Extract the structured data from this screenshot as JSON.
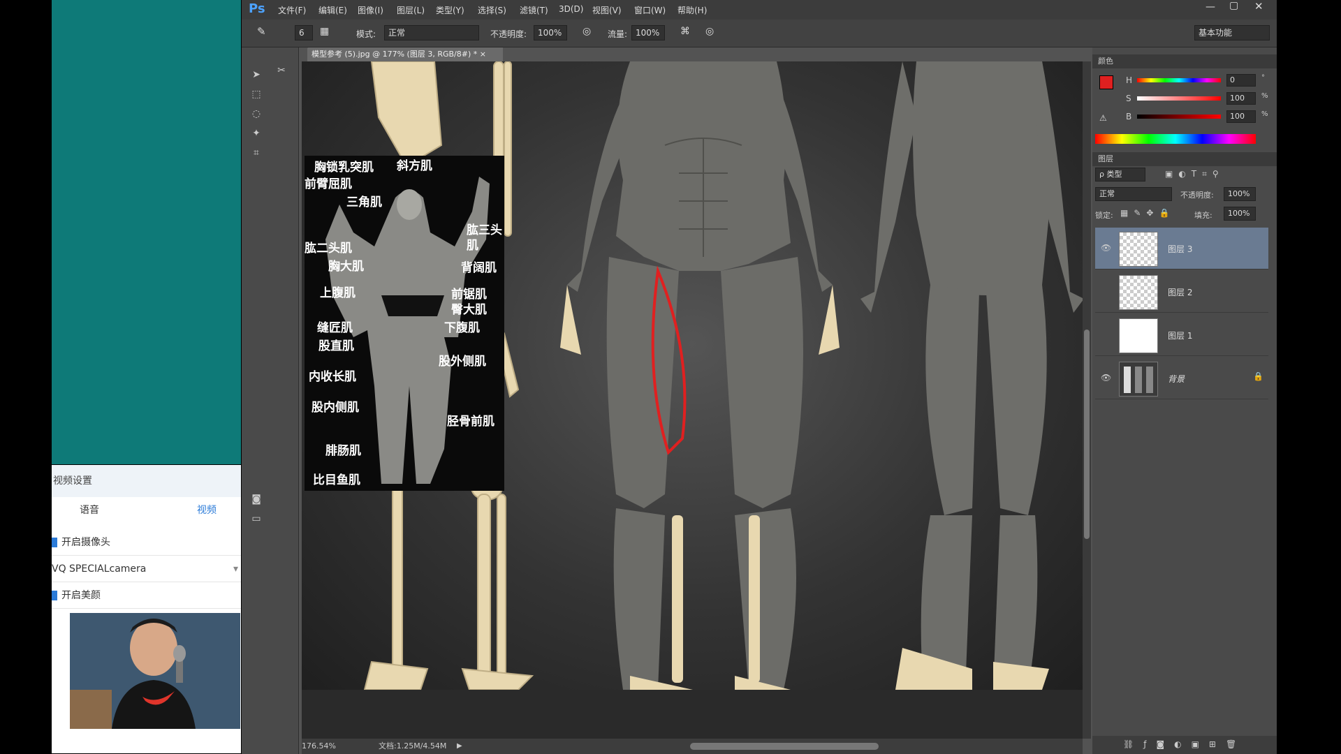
{
  "stream_panel": {
    "settings_title": "视频设置",
    "tab_audio": "语音",
    "tab_video": "视频",
    "enable_camera": "开启摄像头",
    "camera_device": "VQ SPECIALcamera",
    "enable_beauty": "开启美颜"
  },
  "ps": {
    "logo": "Ps",
    "menus": [
      "文件(F)",
      "编辑(E)",
      "图像(I)",
      "图层(L)",
      "类型(Y)",
      "选择(S)",
      "滤镜(T)",
      "3D(D)",
      "视图(V)",
      "窗口(W)",
      "帮助(H)"
    ],
    "options": {
      "brush_size": "6",
      "mode_label": "模式:",
      "mode_value": "正常",
      "opacity_label": "不透明度:",
      "opacity_value": "100%",
      "flow_label": "流量:",
      "flow_value": "100%",
      "workspace": "基本功能"
    },
    "document_tab": "模型参考 (5).jpg @ 177% (图层 3, RGB/8#) * ×",
    "status": {
      "zoom": "176.54%",
      "doc_info": "文档:1.25M/4.54M"
    },
    "color_panel": {
      "title": "颜色",
      "h_label": "H",
      "h_value": "0",
      "s_label": "S",
      "s_value": "100",
      "b_label": "B",
      "b_value": "100",
      "fg_color": "#e02020",
      "h_unit": "°",
      "s_unit": "%",
      "b_unit": "%"
    },
    "layers_panel": {
      "title": "图层",
      "filter_label": "ρ 类型",
      "blend_mode": "正常",
      "opacity_label": "不透明度:",
      "opacity_value": "100%",
      "lock_label": "锁定:",
      "fill_label": "填充:",
      "fill_value": "100%",
      "layers": [
        {
          "name": "图层 3",
          "visible": true,
          "selected": true
        },
        {
          "name": "图层 2",
          "visible": false,
          "selected": false
        },
        {
          "name": "图层 1",
          "visible": false,
          "selected": false
        },
        {
          "name": "背景",
          "visible": true,
          "selected": false,
          "locked": true
        }
      ]
    },
    "muscle_labels": [
      "胸锁乳突肌",
      "斜方肌",
      "前臂屈肌",
      "三角肌",
      "肱二头肌",
      "肱三头肌",
      "胸大肌",
      "背阔肌",
      "上腹肌",
      "前锯肌",
      "臀大肌",
      "缝匠肌",
      "下腹肌",
      "股直肌",
      "股外侧肌",
      "内收长肌",
      "股内侧肌",
      "胫骨前肌",
      "腓肠肌",
      "比目鱼肌"
    ]
  }
}
